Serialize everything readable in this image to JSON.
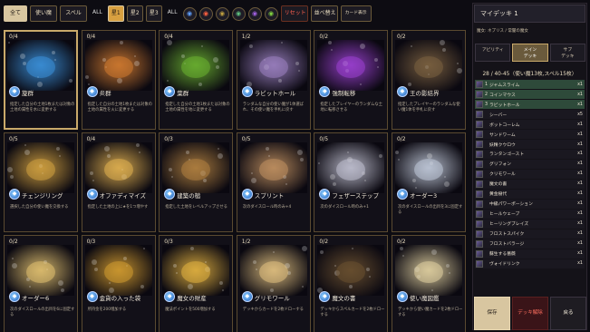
{
  "toolbar": {
    "tabs": [
      "全て",
      "使い魔",
      "スペル"
    ],
    "all_label_1": "ALL",
    "star_filters": [
      "星1",
      "星2",
      "星3"
    ],
    "all_label_2": "ALL",
    "reset_label": "リセット",
    "sort_label": "並べ替え",
    "card_view_label": "カード表示"
  },
  "cards": [
    {
      "cost": "0/4",
      "name": "旋群",
      "desc": "指定した自分の土地1枚または対象の土地の属性を水に変更する",
      "icon": "water-splash",
      "art": "#3a8fd8"
    },
    {
      "cost": "0/4",
      "name": "炎群",
      "desc": "指定した自分の土地1枚または対象の土地の属性を火に変更する",
      "icon": "fire-swirl",
      "art": "#d07a30"
    },
    {
      "cost": "0/4",
      "name": "葉群",
      "desc": "指定した自分の土地1枚または対象の土地の属性を地に変更する",
      "icon": "leaf-sparkle",
      "art": "#6ab030"
    },
    {
      "cost": "1/2",
      "name": "ラビットホール",
      "desc": "ランダムな自分の使い魔が1体選ばれ、その使い魔を手札に戻す",
      "icon": "rabbit-portal",
      "art": "#9a80c0"
    },
    {
      "cost": "0/2",
      "name": "強制転移",
      "desc": "指定したプレイヤーのランダムな土地に転移させる",
      "icon": "purple-vortex",
      "art": "#9a40d0"
    },
    {
      "cost": "0/2",
      "name": "王の影結界",
      "desc": "指定したプレイヤーのランダムな使い魔1体を手札に戻す",
      "icon": "gate",
      "art": "#7a6040"
    },
    {
      "cost": "0/5",
      "name": "チェンジリング",
      "desc": "選択した自分の使い魔を交換する",
      "icon": "infinity-ring",
      "art": "#d0a040"
    },
    {
      "cost": "0/4",
      "name": "オファディマイズ",
      "desc": "指定した土地の上に★を1つ増やす",
      "icon": "star-house",
      "art": "#e0b050"
    },
    {
      "cost": "0/3",
      "name": "建築の槌",
      "desc": "指定した土地をレベルアップさせる",
      "icon": "hammer",
      "art": "#b08040"
    },
    {
      "cost": "0/5",
      "name": "スプリント",
      "desc": "次のダイスロール時のみ+4",
      "icon": "feathers",
      "art": "#c09060"
    },
    {
      "cost": "0/5",
      "name": "フェザーステップ",
      "desc": "次のダイスロール時のみ+1",
      "icon": "bubbles",
      "art": "#c0c0d0"
    },
    {
      "cost": "0/2",
      "name": "オーダー3",
      "desc": "次のダイスロールの出目を3に固定する",
      "icon": "dice-three",
      "art": "#c0c8d8"
    },
    {
      "cost": "0/2",
      "name": "オーダー6",
      "desc": "次のダイスロールの出目を6に固定する",
      "icon": "dice-six",
      "art": "#e0c070"
    },
    {
      "cost": "0/3",
      "name": "金貨の入った袋",
      "desc": "所持金を200増加する",
      "icon": "coin-bag",
      "art": "#d09a30"
    },
    {
      "cost": "0/3",
      "name": "魔女の財産",
      "desc": "魔法ポイントを500増加する",
      "icon": "coin-stacks",
      "art": "#e0b040"
    },
    {
      "cost": "1/2",
      "name": "グリモワール",
      "desc": "デッキからカードを2枚ドローする",
      "icon": "open-book",
      "art": "#e0c080"
    },
    {
      "cost": "0/2",
      "name": "魔文の書",
      "desc": "デッキからスペルカードを2枚ドローする",
      "icon": "closed-book",
      "art": "#6a5030"
    },
    {
      "cost": "0/2",
      "name": "使い魔図鑑",
      "desc": "デッキから使い魔カードを2枚ドローする",
      "icon": "butterfly-book",
      "art": "#e0d0a0"
    }
  ],
  "deck": {
    "name": "マイデッキ 1",
    "hero_line": "魔女: ネプリス / 常闇の魔女",
    "tabs": [
      "アビリティ",
      "メイン\nデッキ",
      "サブ\nデッキ"
    ],
    "count": "28 / 40-45（使い魔13枚,スペル15枚）",
    "items": [
      {
        "n": "1",
        "name": "ジャムスライム",
        "c": "x1"
      },
      {
        "n": "2",
        "name": "コインマウス",
        "c": "x1"
      },
      {
        "n": "3",
        "name": "ラビットホール",
        "c": "x1"
      },
      {
        "n": "",
        "name": "シーバー",
        "c": "x5"
      },
      {
        "n": "",
        "name": "ボットコーレム",
        "c": "x1"
      },
      {
        "n": "",
        "name": "サンドワーム",
        "c": "x1"
      },
      {
        "n": "",
        "name": "妖精クウロウ",
        "c": "x1"
      },
      {
        "n": "",
        "name": "ランタンゴースト",
        "c": "x1"
      },
      {
        "n": "",
        "name": "グリフォン",
        "c": "x1"
      },
      {
        "n": "",
        "name": "クリモワール",
        "c": "x1"
      },
      {
        "n": "",
        "name": "魔文の書",
        "c": "x1"
      },
      {
        "n": "",
        "name": "黄金樹代",
        "c": "x1"
      },
      {
        "n": "",
        "name": "中級パワーポーション",
        "c": "x1"
      },
      {
        "n": "",
        "name": "ヒールウェーブ",
        "c": "x1"
      },
      {
        "n": "",
        "name": "ヒーリングブレイズ",
        "c": "x1"
      },
      {
        "n": "",
        "name": "フロストスパイク",
        "c": "x1"
      },
      {
        "n": "",
        "name": "フロストバラージ",
        "c": "x1"
      },
      {
        "n": "",
        "name": "蘇生する薔薇",
        "c": "x1"
      },
      {
        "n": "",
        "name": "ヴォイドリンク",
        "c": "x1"
      }
    ],
    "save_label": "保存",
    "disband_label": "デッキ解除",
    "back_label": "戻る"
  },
  "colors": {
    "accent": "#c9a96a",
    "panel": "#141218",
    "highlight": "#2e4a3a"
  }
}
